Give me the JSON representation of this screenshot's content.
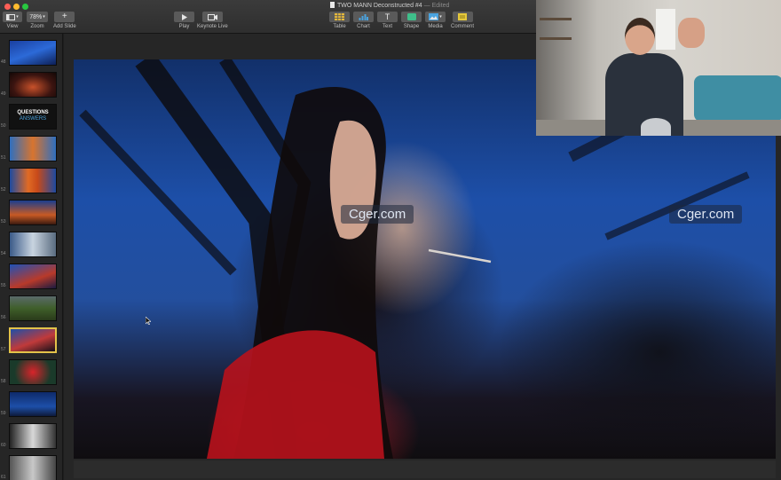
{
  "window": {
    "title": "TWO MANN Deconstructed #4",
    "edited": "— Edited",
    "colors": {
      "close": "#ff5f57",
      "minimize": "#febc2e",
      "zoom": "#28c840",
      "selection": "#e3c34a"
    }
  },
  "toolbar": {
    "view": {
      "label": "View",
      "icon": "sidebar-view-icon"
    },
    "zoom": {
      "label": "Zoom",
      "value": "78%"
    },
    "add_slide": {
      "label": "Add Slide",
      "icon": "plus-icon"
    },
    "play": {
      "label": "Play",
      "icon": "play-icon"
    },
    "keynote_live": {
      "label": "Keynote Live",
      "icon": "broadcast-icon"
    },
    "table": {
      "label": "Table",
      "icon": "table-icon"
    },
    "chart": {
      "label": "Chart",
      "icon": "chart-icon"
    },
    "text": {
      "label": "Text",
      "glyph": "T"
    },
    "shape": {
      "label": "Shape",
      "icon": "shape-icon"
    },
    "media": {
      "label": "Media",
      "icon": "media-icon"
    },
    "comment": {
      "label": "Comment",
      "icon": "comment-icon"
    }
  },
  "slides": [
    {
      "number": "48"
    },
    {
      "number": "49"
    },
    {
      "number": "50",
      "title": "QUESTIONS",
      "subtitle": "ANSWERS"
    },
    {
      "number": "51"
    },
    {
      "number": "52"
    },
    {
      "number": "53"
    },
    {
      "number": "54"
    },
    {
      "number": "55"
    },
    {
      "number": "56"
    },
    {
      "number": "57",
      "selected": true
    },
    {
      "number": "58"
    },
    {
      "number": "59"
    },
    {
      "number": "60"
    },
    {
      "number": "61"
    }
  ],
  "watermarks": [
    "Cger.com",
    "Cger.com"
  ]
}
